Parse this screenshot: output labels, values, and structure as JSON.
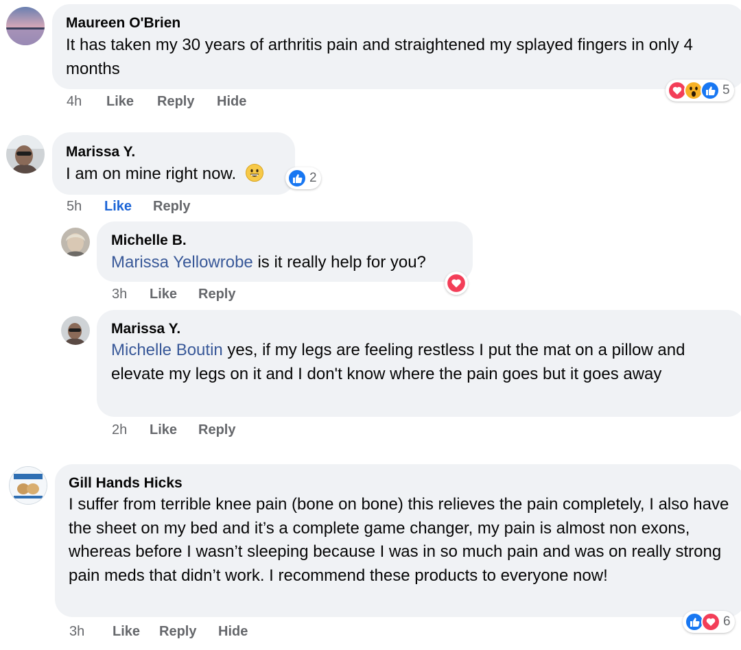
{
  "comments": [
    {
      "author": "Maureen O'Brien",
      "text": "It has taken my 30 years of arthritis pain and straightened my splayed fingers in only 4 months",
      "time": "4h",
      "like": "Like",
      "reply": "Reply",
      "hide": "Hide",
      "reaction_count": "5"
    },
    {
      "author": "Marissa Y.",
      "text": "I am on mine right now.",
      "time": "5h",
      "like": "Like",
      "reply": "Reply",
      "reaction_count": "2",
      "replies": [
        {
          "author": "Michelle B.",
          "mention": "Marissa Yellowrobe",
          "text": " is it really help for you?",
          "time": "3h",
          "like": "Like",
          "reply": "Reply"
        },
        {
          "author": "Marissa Y.",
          "mention": "Michelle Boutin",
          "text": " yes, if my legs are feeling restless I put the mat on a pillow and elevate my legs on it and I don't know where the pain goes but it goes away",
          "time": "2h",
          "like": "Like",
          "reply": "Reply"
        }
      ]
    },
    {
      "author": "Gill Hands Hicks",
      "text": "I suffer from terrible knee pain (bone on bone) this relieves the pain completely, I also have the sheet on my bed and it’s a complete game changer, my pain is almost non exons, whereas before I wasn’t sleeping because I was in so much pain and was on really strong pain meds that didn’t work. I recommend these products to everyone now!",
      "time": "3h",
      "like": "Like",
      "reply": "Reply",
      "hide": "Hide",
      "reaction_count": "6"
    }
  ],
  "colors": {
    "bubble": "#f0f2f5",
    "mention": "#385898",
    "liked": "#1b64d6",
    "action": "#65676b",
    "like_blue": "#1877f2",
    "love_red": "#f33e58",
    "wow_yellow": "#f7b125"
  },
  "icons": [
    "love-icon",
    "wow-icon",
    "like-icon",
    "grinning-emoji-icon"
  ]
}
